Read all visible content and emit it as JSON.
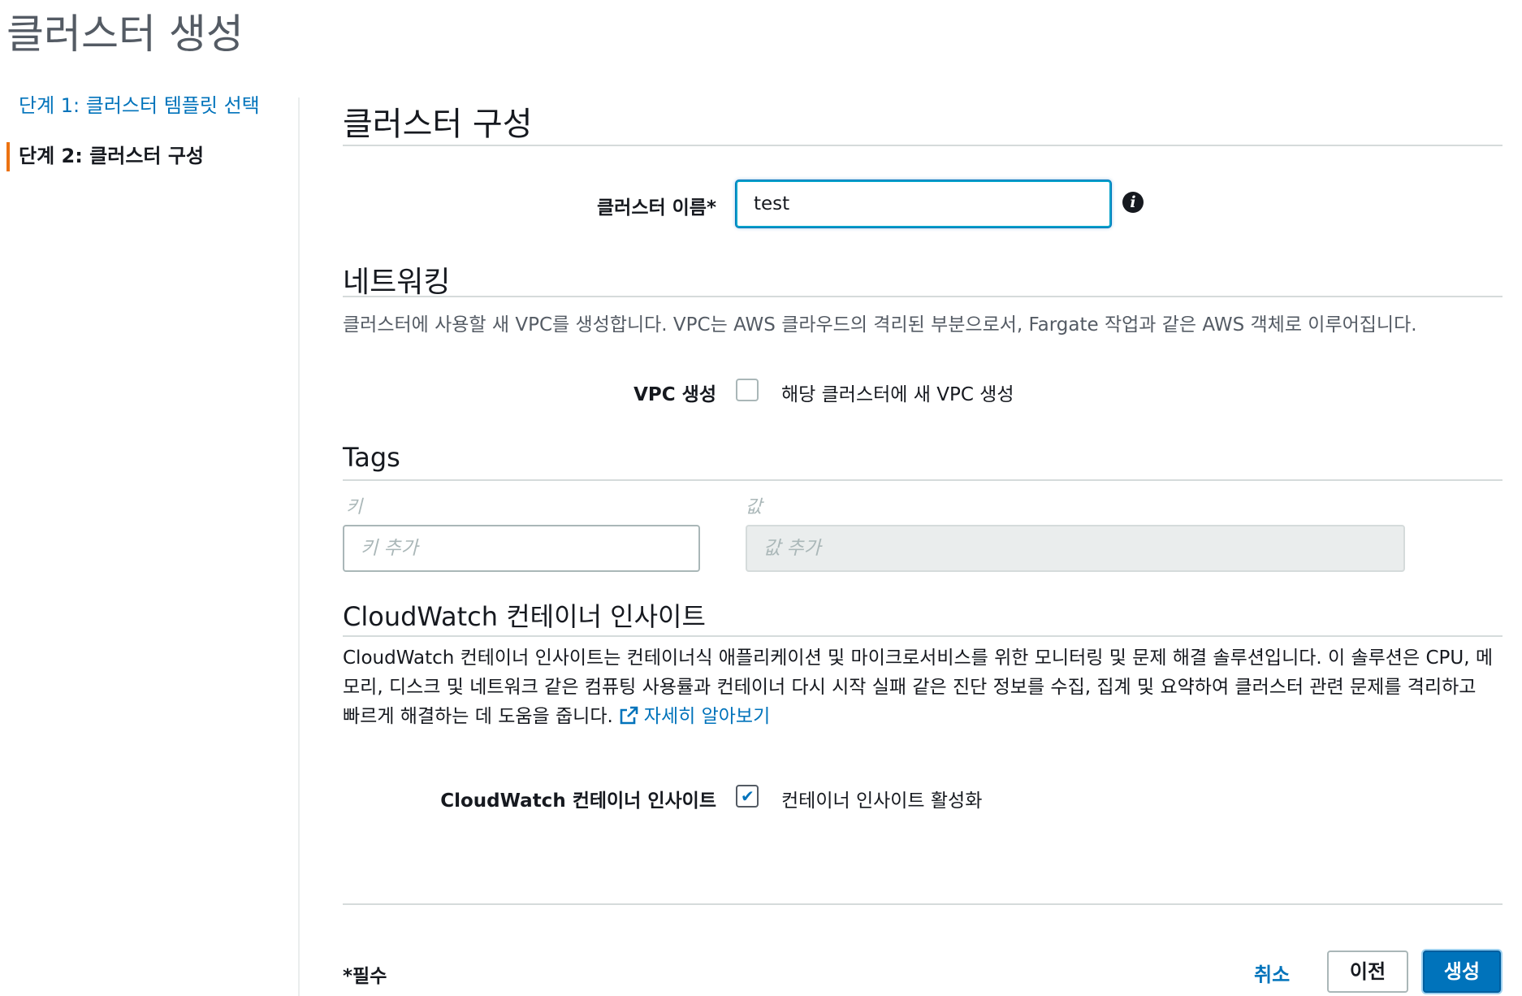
{
  "page": {
    "title": "클러스터 생성"
  },
  "steps": [
    {
      "label": "단계 1: 클러스터 템플릿 선택",
      "state": "link"
    },
    {
      "label": "단계 2: 클러스터 구성",
      "state": "active"
    }
  ],
  "configure": {
    "heading": "클러스터 구성",
    "cluster_name_label": "클러스터 이름*",
    "cluster_name_value": "test",
    "info_icon": "info-icon"
  },
  "networking": {
    "heading": "네트워킹",
    "description": "클러스터에 사용할 새 VPC를 생성합니다. VPC는 AWS 클라우드의 격리된 부분으로서, Fargate 작업과 같은 AWS 객체로 이루어집니다.",
    "vpc_label": "VPC 생성",
    "vpc_checkbox_text": "해당 클러스터에 새 VPC 생성",
    "vpc_checked": false
  },
  "tags": {
    "heading": "Tags",
    "key_column": "키",
    "value_column": "값",
    "key_placeholder": "키 추가",
    "value_placeholder": "값 추가"
  },
  "cloudwatch": {
    "heading": "CloudWatch 컨테이너 인사이트",
    "description": "CloudWatch 컨테이너 인사이트는 컨테이너식 애플리케이션 및 마이크로서비스를 위한 모니터링 및 문제 해결 솔루션입니다. 이 솔루션은 CPU, 메모리, 디스크 및 네트워크 같은 컴퓨팅 사용률과 컨테이너 다시 시작 실패 같은 진단 정보를 수집, 집계 및 요약하여 클러스터 관련 문제를 격리하고 빠르게 해결하는 데 도움을 줍니다.",
    "learn_more": "자세히 알아보기",
    "learn_more_icon": "external-link-icon",
    "insights_label": "CloudWatch 컨테이너 인사이트",
    "insights_checkbox_text": "컨테이너 인사이트 활성화",
    "insights_checked": true
  },
  "footer": {
    "required_note": "*필수",
    "cancel_label": "취소",
    "previous_label": "이전",
    "create_label": "생성"
  },
  "colors": {
    "accent": "#0073bb",
    "active_step_marker": "#ec7211",
    "divider": "#d5dbdb"
  }
}
